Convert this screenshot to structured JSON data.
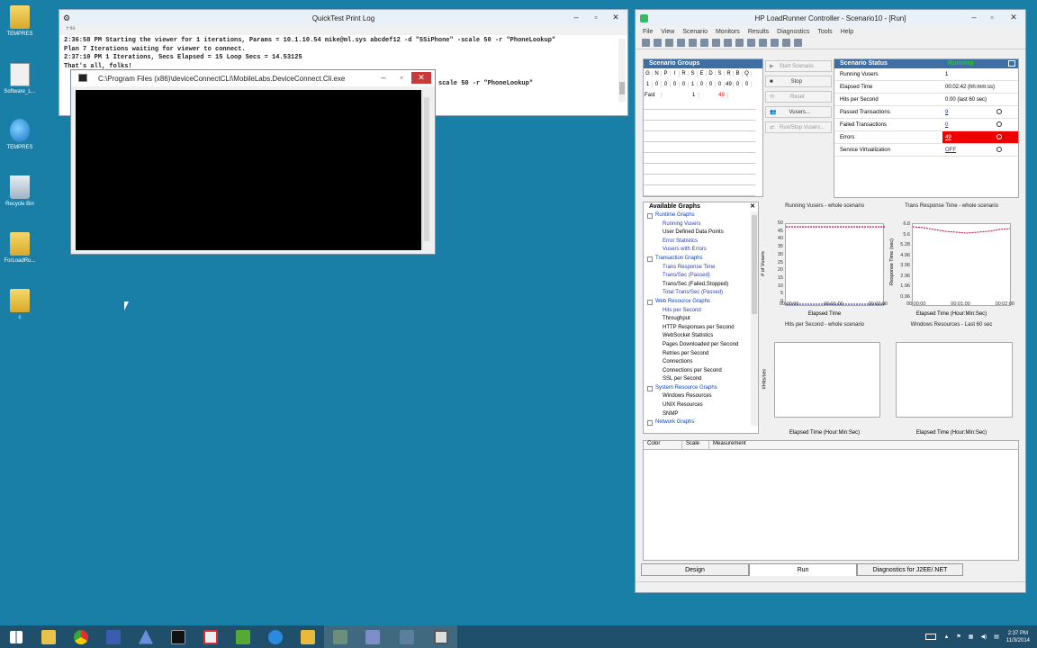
{
  "desktop": {
    "icons": [
      {
        "label": "TEMPRES",
        "icon": "folder-icon"
      },
      {
        "label": "Software_L...",
        "icon": "software-icon"
      },
      {
        "label": "TEMPRES",
        "icon": "ie-icon"
      },
      {
        "label": "Recycle Bin",
        "icon": "recycle-bin-icon"
      },
      {
        "label": "ForLoadRu...",
        "icon": "folder-icon"
      },
      {
        "label": "c",
        "icon": "folder-icon"
      }
    ]
  },
  "quicktest": {
    "title": "QuickTest Print Log",
    "menu": "File",
    "log_lines": [
      "2:36:58 PM Starting the viewer for 1 iterations, Params = 10.1.10.54 mike@ml.sys abcdef12 -d \"5SiPhone\" -scale 50 -r \"PhoneLookup\"",
      "Plan 7 Iterations waiting for viewer to connect.",
      "2:37:10 PM 1 Iterations, Secs Elapsed = 15 Loop Secs = 14.53125",
      "That's all, folks!",
      "",
      "scale 50 -r \"PhoneLookup\""
    ]
  },
  "console": {
    "title": "C:\\Program Files (x86)\\deviceConnectCLI\\MobileLabs.DeviceConnect.Cli.exe"
  },
  "loadrunner": {
    "title": "HP LoadRunner Controller - Scenario10 - [Run]",
    "menu": [
      "File",
      "View",
      "Scenario",
      "Monitors",
      "Results",
      "Diagnostics",
      "Tools",
      "Help"
    ],
    "scenario_groups": {
      "header": "Scenario Groups",
      "columns": [
        "G",
        "N",
        "P",
        "I",
        "R",
        "S",
        "E",
        "D",
        "S",
        "R",
        "B",
        "Q",
        "F"
      ],
      "row1": [
        "1",
        "0",
        "0",
        "0",
        "0",
        "1",
        "0",
        "0",
        "0",
        "49",
        "0",
        "0",
        "0"
      ],
      "row2": [
        "Fast",
        "",
        "",
        "",
        "",
        "1",
        "",
        "",
        "",
        "49",
        "",
        "",
        ""
      ]
    },
    "buttons": {
      "start": "Start Scenario",
      "stop": "Stop",
      "reset": "Reset",
      "vusers": "Vusers...",
      "run_stop": "Run/Stop Vusers..."
    },
    "status": {
      "header": "Scenario Status",
      "state": "Running",
      "rows": [
        {
          "k": "Running Vusers",
          "v": "1"
        },
        {
          "k": "Elapsed Time",
          "v": "00:02:42 (hh:mm:ss)"
        },
        {
          "k": "Hits per Second",
          "v": "0.00 (last 60 sec)"
        },
        {
          "k": "Passed Transactions",
          "v": "9"
        },
        {
          "k": "Failed Transactions",
          "v": "0"
        },
        {
          "k": "Errors",
          "v": "49"
        },
        {
          "k": "Service Virtualization",
          "v": "OFF"
        }
      ]
    },
    "available_graphs": {
      "header": "Available Graphs",
      "items": [
        {
          "t": "Runtime Graphs",
          "type": "cat"
        },
        {
          "t": "Running Vusers",
          "type": "sub blue"
        },
        {
          "t": "User Defined Data Points",
          "type": "sub"
        },
        {
          "t": "Error Statistics",
          "type": "sub blue"
        },
        {
          "t": "Vusers with Errors",
          "type": "sub blue"
        },
        {
          "t": "Transaction Graphs",
          "type": "cat"
        },
        {
          "t": "Trans Response Time",
          "type": "sub blue"
        },
        {
          "t": "Trans/Sec (Passed)",
          "type": "sub blue"
        },
        {
          "t": "Trans/Sec (Failed,Stopped)",
          "type": "sub"
        },
        {
          "t": "Total Trans/Sec (Passed)",
          "type": "sub blue"
        },
        {
          "t": "Web Resource Graphs",
          "type": "cat"
        },
        {
          "t": "Hits per Second",
          "type": "sub blue"
        },
        {
          "t": "Throughput",
          "type": "sub"
        },
        {
          "t": "HTTP Responses per Second",
          "type": "sub"
        },
        {
          "t": "WebSocket Statistics",
          "type": "sub"
        },
        {
          "t": "Pages Downloaded per Second",
          "type": "sub"
        },
        {
          "t": "Retries per Second",
          "type": "sub"
        },
        {
          "t": "Connections",
          "type": "sub"
        },
        {
          "t": "Connections per Second",
          "type": "sub"
        },
        {
          "t": "SSL per Second",
          "type": "sub"
        },
        {
          "t": "System Resource Graphs",
          "type": "cat"
        },
        {
          "t": "Windows Resources",
          "type": "sub"
        },
        {
          "t": "UNIX Resources",
          "type": "sub"
        },
        {
          "t": "SNMP",
          "type": "sub"
        },
        {
          "t": "Network Graphs",
          "type": "cat"
        }
      ]
    },
    "graphs": {
      "g1": {
        "title": "Running Vusers - whole scenario",
        "xlabel": "Elapsed Time",
        "ylabel": "# of Vusers",
        "yticks": [
          "50",
          "45",
          "40",
          "35",
          "30",
          "25",
          "20",
          "15",
          "10",
          "5",
          "0"
        ],
        "xticks": [
          "00:00:00",
          "00:01:00",
          "00:02:00"
        ]
      },
      "g2": {
        "title": "Trans Response Time - whole scenario",
        "xlabel": "Elapsed Time (Hour:Min:Sec)",
        "ylabel": "Response Time (sec)",
        "yticks": [
          "6.8",
          "5.6",
          "5.28",
          "4.96",
          "3.96",
          "2.96",
          "1.96",
          "0.96"
        ],
        "xticks": [
          "00:00:00",
          "00:01:00",
          "00:02:00"
        ]
      },
      "g3": {
        "title": "Hits per Second - whole scenario",
        "xlabel": "Elapsed Time (Hour:Min:Sec)",
        "ylabel": "#Hits/sec"
      },
      "g4": {
        "title": "Windows Resources - Last 60 sec",
        "xlabel": "Elapsed Time (Hour:Min:Sec)"
      }
    },
    "legend_cols": [
      "Color",
      "Scale",
      "Measurement"
    ],
    "tabs": [
      "Design",
      "Run",
      "Diagnostics for J2EE/.NET"
    ]
  },
  "clock": {
    "time": "2:37 PM",
    "date": "11/3/2014"
  },
  "colors": {
    "desktop": "#1a7fa6",
    "taskbar": "#1f4f6a",
    "errors": "#e00000",
    "running": "#22cc22"
  }
}
